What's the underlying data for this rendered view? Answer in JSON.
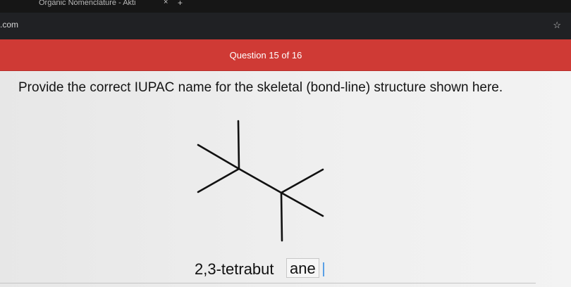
{
  "browser": {
    "tab_title": "Organic Nomenclature - Akti",
    "tab_close": "×",
    "new_tab": "+",
    "url_fragment": ".com",
    "bookmark_icon": "☆"
  },
  "quiz": {
    "counter": "Question 15 of 16",
    "prompt": "Provide the correct IUPAC name for the skeletal (bond-line) structure shown here."
  },
  "answer": {
    "part1": "2,3-tetrabut",
    "part2": "ane"
  },
  "colors": {
    "header_red": "#cf3a35",
    "cursor_blue": "#5aa0e6"
  },
  "icons": [
    "close-icon",
    "plus-icon",
    "star-icon"
  ]
}
